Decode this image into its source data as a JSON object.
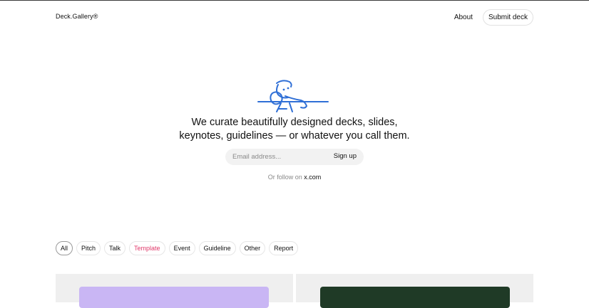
{
  "header": {
    "logo": "Deck.Gallery®",
    "nav": {
      "about": "About",
      "submit": "Submit deck"
    }
  },
  "hero": {
    "illustration": "reclining-person-illustration",
    "line1": "We curate beautifully designed decks, slides,",
    "line2": "keynotes, guidelines — or whatever you call them."
  },
  "signup": {
    "placeholder": "Email address...",
    "button": "Sign up"
  },
  "follow": {
    "prefix": "Or follow on",
    "link": "x.com"
  },
  "filters": [
    "All",
    "Pitch",
    "Talk",
    "Template",
    "Event",
    "Guideline",
    "Other",
    "Report"
  ],
  "colors": {
    "accent_illustration": "#2f6fd6",
    "template_chip": "#e0396a",
    "card_purple": "#c9b6f4",
    "card_green": "#1f3a26"
  }
}
